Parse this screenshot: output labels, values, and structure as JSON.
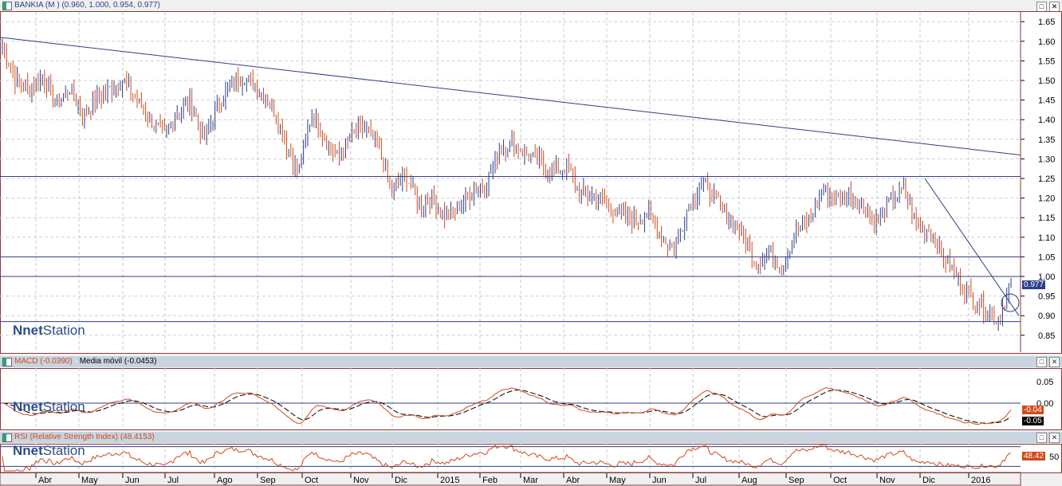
{
  "main": {
    "title": "BANKIA (M ) (0.960, 1.000, 0.954, 0.977)",
    "last_label": "0.977",
    "watermark_n": "N",
    "watermark_net": "net",
    "watermark_station": "Station"
  },
  "macd": {
    "title_macd": "MACD (-0.0390)",
    "sep": " - ",
    "title_ma": "Media móvil (-0.0453)",
    "macd_label": "-0.04",
    "ma_label": "-0.05"
  },
  "rsi": {
    "title": "RSI (Relative Strength Index) (48.4153)",
    "label": "48.42"
  },
  "buttons": {
    "maximize": "□",
    "close": "✕"
  },
  "colors": {
    "up": "#2d3f8a",
    "down": "#d04a1c",
    "line": "#2d3f8a",
    "macd": "#d04a1c",
    "signal": "#000000"
  },
  "chart_data": {
    "type": "ohlc",
    "title": "BANKIA (M )",
    "last_ohlc": {
      "open": 0.96,
      "high": 1.0,
      "low": 0.954,
      "close": 0.977
    },
    "y_ticks": [
      "1.65",
      "1.60",
      "1.55",
      "1.50",
      "1.45",
      "1.40",
      "1.35",
      "1.30",
      "1.25",
      "1.20",
      "1.15",
      "1.10",
      "1.05",
      "1.00",
      "0.95",
      "0.90",
      "0.85"
    ],
    "ylim": [
      0.82,
      1.68
    ],
    "x_ticks": [
      "Abr",
      "May",
      "Jun",
      "Jul",
      "Ago",
      "Sep",
      "Oct",
      "Nov",
      "Dic",
      "2015",
      "Feb",
      "Mar",
      "Abr",
      "May",
      "Jun",
      "Jul",
      "Aug",
      "Sep",
      "Oct",
      "Nov",
      "Dic",
      "2016"
    ],
    "approx_closes": [
      1.59,
      1.5,
      1.48,
      1.51,
      1.44,
      1.48,
      1.41,
      1.45,
      1.48,
      1.5,
      1.45,
      1.4,
      1.36,
      1.42,
      1.44,
      1.35,
      1.44,
      1.49,
      1.51,
      1.48,
      1.44,
      1.35,
      1.26,
      1.42,
      1.35,
      1.3,
      1.36,
      1.38,
      1.32,
      1.22,
      1.26,
      1.18,
      1.2,
      1.15,
      1.18,
      1.22,
      1.24,
      1.33,
      1.34,
      1.31,
      1.29,
      1.27,
      1.28,
      1.21,
      1.21,
      1.18,
      1.16,
      1.14,
      1.16,
      1.1,
      1.07,
      1.18,
      1.24,
      1.2,
      1.15,
      1.11,
      1.03,
      1.07,
      1.02,
      1.12,
      1.14,
      1.22,
      1.2,
      1.21,
      1.18,
      1.14,
      1.19,
      1.22,
      1.13,
      1.12,
      1.05,
      1.0,
      0.95,
      0.92,
      0.89,
      0.977
    ],
    "horizontal_lines": [
      1.255,
      1.05,
      1.0,
      0.885
    ],
    "trendlines": [
      {
        "from": 1.61,
        "to": 1.31
      },
      {
        "from": 1.25,
        "to": 0.9
      }
    ],
    "macd_ticks": [
      "0.05",
      "0.00"
    ],
    "rsi_ticks": [
      "50"
    ],
    "rsi_levels": [
      70,
      30
    ]
  }
}
